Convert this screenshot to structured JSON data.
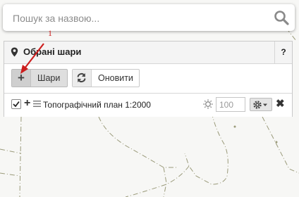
{
  "search": {
    "placeholder": "Пошук за назвою..."
  },
  "panel": {
    "title": "Обрані шари",
    "help_label": "?",
    "add_button_label": "Шари",
    "refresh_button_label": "Оновити"
  },
  "layers": [
    {
      "name": "Топографічний план 1:2000",
      "checked": true,
      "opacity": "100"
    }
  ],
  "annotation": {
    "number": "1"
  },
  "icons": {
    "search": "search-icon",
    "pin": "map-marker-icon",
    "add": "plus-icon",
    "refresh": "refresh-icon",
    "drag": "drag-handle-icon",
    "brightness": "sun-icon",
    "settings": "gear-icon",
    "remove": "close-icon"
  },
  "colors": {
    "annotation": "#cc1e1e",
    "map_background": "#f7f7f5",
    "map_lines": "#9a9a7a"
  }
}
